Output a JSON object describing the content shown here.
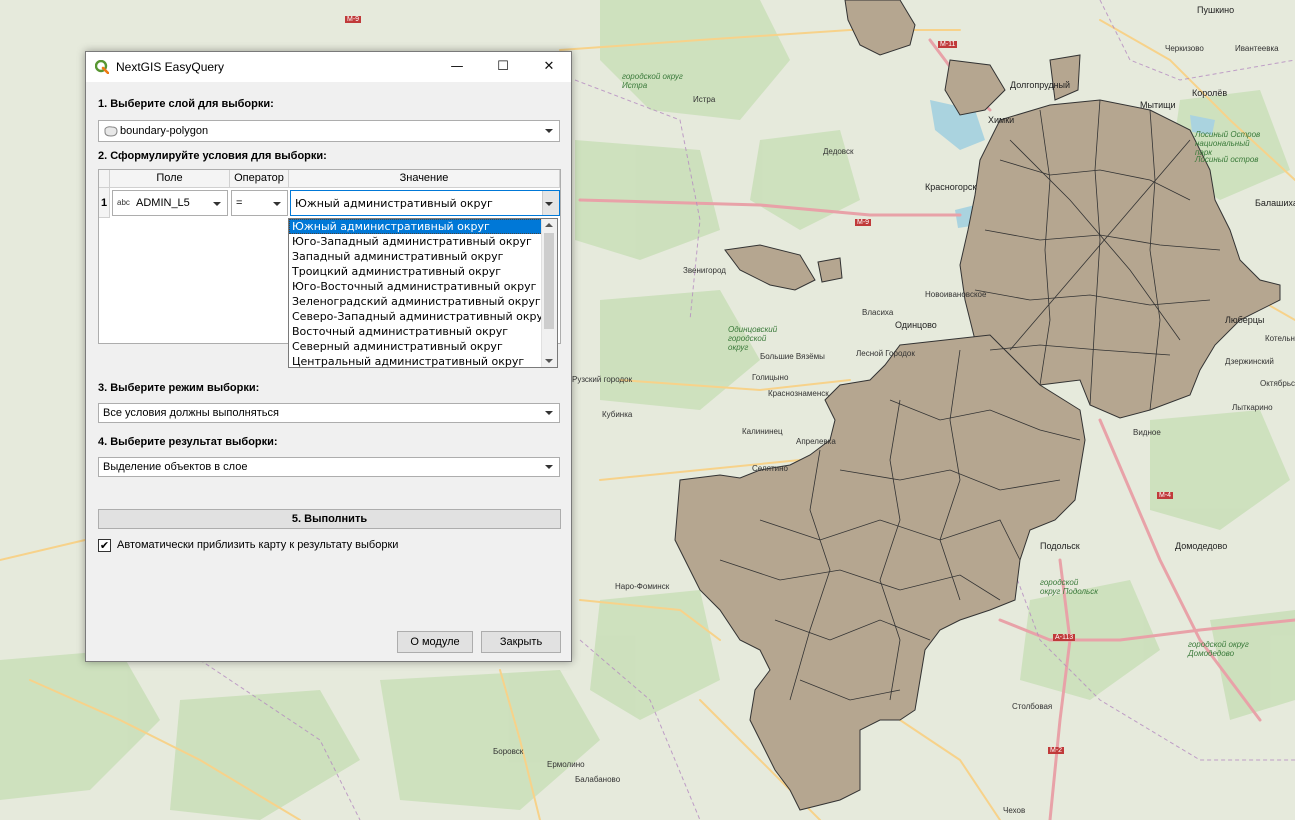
{
  "window": {
    "title": "NextGIS EasyQuery",
    "minimize_glyph": "—",
    "maximize_glyph": "☐",
    "close_glyph": "✕"
  },
  "step1": {
    "label": "1. Выберите слой для выборки:",
    "layer_value": "boundary-polygon"
  },
  "step2": {
    "label": "2. Сформулируйте условия для выборки:",
    "columns": [
      "Поле",
      "Оператор",
      "Значение"
    ],
    "row_number": "1",
    "field_type_tag": "abc",
    "field_value": "ADMIN_L5",
    "operator_value": "=",
    "value_selected": "Южный административный округ",
    "value_options": [
      "Южный административный округ",
      "Юго-Западный административный округ",
      "Западный административный округ",
      "Троицкий административный округ",
      "Юго-Восточный административный округ",
      "Зеленоградский административный округ",
      "Северо-Западный административный округ",
      "Восточный административный округ",
      "Северный административный округ",
      "Центральный административный округ"
    ]
  },
  "step3": {
    "label": "3. Выберите режим выборки:",
    "value": "Все условия должны выполняться"
  },
  "step4": {
    "label": "4. Выберите результат выборки:",
    "value": "Выделение объектов в слое"
  },
  "run_button": "5. Выполнить",
  "auto_zoom": {
    "checked": true,
    "check_glyph": "✔",
    "label": "Автоматически приблизить карту к результату выборки"
  },
  "footer": {
    "about_button": "О модуле",
    "close_button": "Закрыть"
  },
  "map": {
    "colors": {
      "land": "#e6eadc",
      "forest": "#c9dfb8",
      "polygon": "#b5a690",
      "road_major": "#e8a2a8",
      "road": "#f7d28a",
      "water": "#aad3df"
    },
    "labels": [
      "Пушкино",
      "Черкизово",
      "Ивантеевка",
      "Долгопрудный",
      "Мытищи",
      "Королёв",
      "Химки",
      "Лосиный остров",
      "Балашиха",
      "Красногорск",
      "Истра",
      "Дедовск",
      "Звенигород",
      "Одинцово",
      "Власиха",
      "Новоивановское",
      "Большие Вязёмы",
      "Голицыно",
      "Краснознаменск",
      "Лесной Городок",
      "Кубинка",
      "Калининец",
      "Апрелевка",
      "Селятино",
      "Наро-Фоминск",
      "Видное",
      "Подольск",
      "Домодедово",
      "Дзержинский",
      "Лыткарино",
      "Люберцы",
      "Котельники",
      "Октябрьский",
      "Столбовая",
      "Чехов",
      "Боровск",
      "Ермолино",
      "Балабаново",
      "Рузский городок",
      "городской округ Истра",
      "городской округ Домодедово",
      "городской округ Подольск",
      "Одинцовский городской округ",
      "Лосиный Остров национальный парк"
    ],
    "roads": [
      "М-9",
      "М-11",
      "М-4",
      "М-2",
      "А-113",
      "М-9"
    ]
  }
}
